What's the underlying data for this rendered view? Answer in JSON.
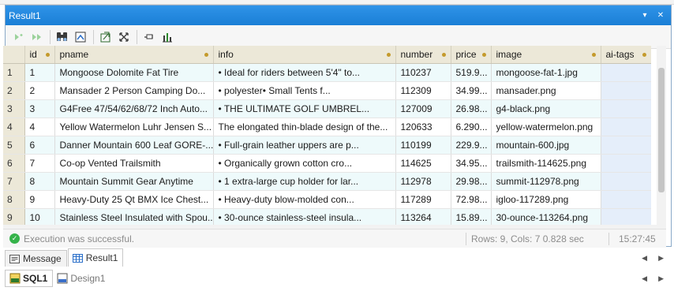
{
  "panel": {
    "title": "Result1",
    "pin_glyph": "▾",
    "close_glyph": "✕"
  },
  "toolbar": {
    "icons": [
      "add-row-icon",
      "next-icon",
      "find-icon",
      "bookmark-icon",
      "export-icon",
      "resize-icon",
      "pin-icon",
      "chart-icon"
    ]
  },
  "grid": {
    "columns": [
      "id",
      "pname",
      "info",
      "number",
      "price",
      "image",
      "ai-tags"
    ],
    "rows": [
      {
        "rn": "1",
        "id": "1",
        "pname": "Mongoose Dolomite Fat Tire",
        "info": "•           Ideal for riders between 5'4\" to...",
        "number": "110237",
        "price": "519.9...",
        "image": "mongoose-fat-1.jpg",
        "aitags": ""
      },
      {
        "rn": "2",
        "id": "2",
        "pname": "Mansader 2 Person Camping Do...",
        "info": "•           polyester•             Small Tents f...",
        "number": "112309",
        "price": "34.99...",
        "image": "mansader.png",
        "aitags": ""
      },
      {
        "rn": "3",
        "id": "3",
        "pname": "G4Free 47/54/62/68/72 Inch Auto...",
        "info": "•           THE ULTIMATE GOLF UMBREL...",
        "number": "127009",
        "price": "26.98...",
        "image": "g4-black.png",
        "aitags": ""
      },
      {
        "rn": "4",
        "id": "4",
        "pname": "Yellow Watermelon Luhr Jensen S...",
        "info": "The elongated thin-blade design of the...",
        "number": "120633",
        "price": "6.290...",
        "image": "yellow-watermelon.png",
        "aitags": ""
      },
      {
        "rn": "5",
        "id": "6",
        "pname": "Danner Mountain 600 Leaf GORE-...",
        "info": "•           Full-grain leather uppers are p...",
        "number": "110199",
        "price": "229.9...",
        "image": "mountain-600.jpg",
        "aitags": ""
      },
      {
        "rn": "6",
        "id": "7",
        "pname": "Co-op Vented Trailsmith",
        "info": "•           Organically grown cotton cro...",
        "number": "114625",
        "price": "34.95...",
        "image": "trailsmith-114625.png",
        "aitags": ""
      },
      {
        "rn": "7",
        "id": "8",
        "pname": "Mountain Summit Gear Anytime",
        "info": "•           1 extra-large cup holder for lar...",
        "number": "112978",
        "price": "29.98...",
        "image": "summit-112978.png",
        "aitags": ""
      },
      {
        "rn": "8",
        "id": "9",
        "pname": "Heavy-Duty 25 Qt BMX Ice Chest...",
        "info": "•           Heavy-duty blow-molded con...",
        "number": "117289",
        "price": "72.98...",
        "image": "igloo-117289.png",
        "aitags": ""
      },
      {
        "rn": "9",
        "id": "10",
        "pname": "Stainless Steel Insulated with Spou...",
        "info": "•           30-ounce stainless-steel insula...",
        "number": "113264",
        "price": "15.89...",
        "image": "30-ounce-113264.png",
        "aitags": ""
      }
    ]
  },
  "status": {
    "message": "Execution was successful.",
    "rows_cols": "Rows: 9, Cols: 7",
    "duration": "0.828 sec",
    "time": "15:27:45"
  },
  "result_tabs": [
    {
      "label": "Message",
      "icon": "message-icon",
      "active": false
    },
    {
      "label": "Result1",
      "icon": "grid-icon",
      "active": true
    }
  ],
  "editor_tabs": [
    {
      "label": "SQL1",
      "icon": "sql-icon",
      "active": true
    },
    {
      "label": "Design1",
      "icon": "design-icon",
      "active": false
    }
  ],
  "colors": {
    "title_bar": "#1a7fd6",
    "header_bg": "#ece8d8",
    "alt_row": "#eefafb",
    "ai_tags_bg": "#e5eefa",
    "success": "#35b34a"
  }
}
